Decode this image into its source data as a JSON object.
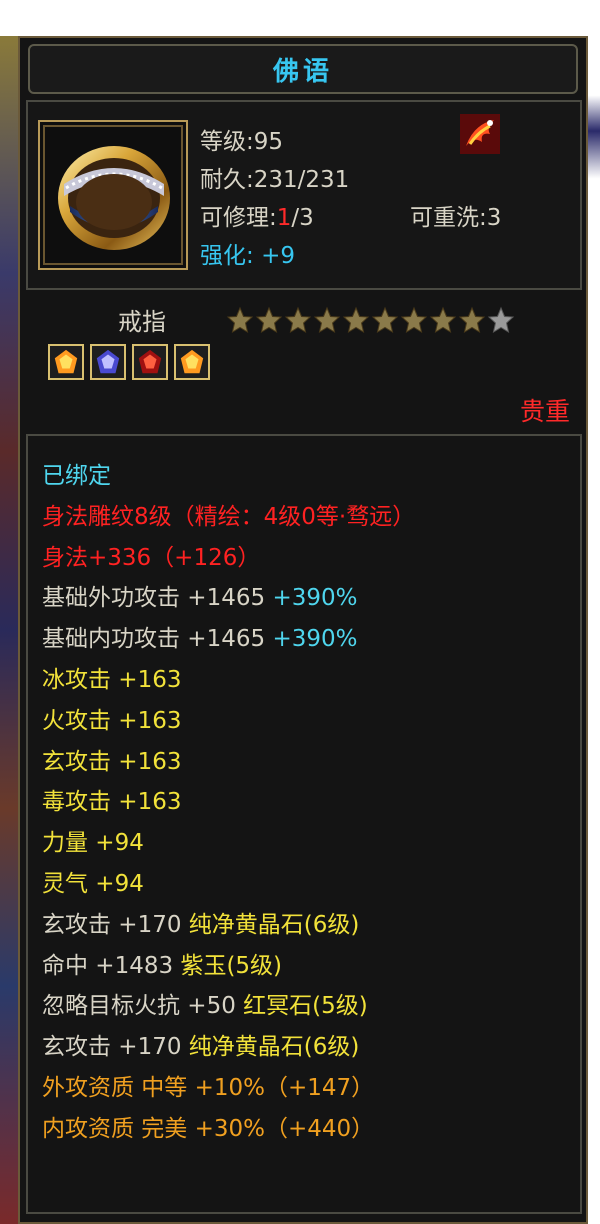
{
  "colors": {
    "title": "#37c6f0",
    "red": "#ff2222",
    "yellow": "#f2e23a",
    "orange": "#f0a020",
    "cyan": "#4fd6ee",
    "white": "#d8d4c6"
  },
  "item": {
    "name": "佛语",
    "level_label": "等级",
    "level_value": "95",
    "durability_label": "耐久",
    "durability_value": "231/231",
    "repair_label": "可修理",
    "repair_current": "1",
    "repair_total": "/3",
    "rewash_label": "可重洗",
    "rewash_value": "3",
    "enhance_label": "强化",
    "enhance_value": "+9",
    "type": "戒指",
    "stars_filled": 9,
    "stars_total": 10,
    "gem_icons": [
      "yellow-gem-icon",
      "purple-gem-icon",
      "red-gem-icon",
      "yellow-gem-icon"
    ],
    "rarity": "贵重"
  },
  "attributes": [
    {
      "parts": [
        {
          "text": "已绑定",
          "color": "cyan"
        }
      ]
    },
    {
      "parts": [
        {
          "text": "身法雕纹8级（精绘：4级0等·骛远）",
          "color": "red"
        }
      ]
    },
    {
      "parts": [
        {
          "text": "身法+336（+126）",
          "color": "red"
        }
      ]
    },
    {
      "parts": [
        {
          "text": "基础外功攻击 +1465 ",
          "color": "white"
        },
        {
          "text": "+390%",
          "color": "cyan"
        }
      ]
    },
    {
      "parts": [
        {
          "text": "基础内功攻击 +1465 ",
          "color": "white"
        },
        {
          "text": "+390%",
          "color": "cyan"
        }
      ]
    },
    {
      "parts": [
        {
          "text": "冰攻击 +163",
          "color": "yellow"
        }
      ]
    },
    {
      "parts": [
        {
          "text": "火攻击 +163",
          "color": "yellow"
        }
      ]
    },
    {
      "parts": [
        {
          "text": "玄攻击 +163",
          "color": "yellow"
        }
      ]
    },
    {
      "parts": [
        {
          "text": "毒攻击 +163",
          "color": "yellow"
        }
      ]
    },
    {
      "parts": [
        {
          "text": "力量 +94",
          "color": "yellow"
        }
      ]
    },
    {
      "parts": [
        {
          "text": "灵气 +94",
          "color": "yellow"
        }
      ]
    },
    {
      "parts": [
        {
          "text": "玄攻击 +170 ",
          "color": "white"
        },
        {
          "text": "纯净黄晶石(6级)",
          "color": "yellow"
        }
      ]
    },
    {
      "parts": [
        {
          "text": "命中 +1483 ",
          "color": "white"
        },
        {
          "text": "紫玉(5级)",
          "color": "yellow"
        }
      ]
    },
    {
      "parts": [
        {
          "text": "忽略目标火抗 +50 ",
          "color": "white"
        },
        {
          "text": "红冥石(5级)",
          "color": "yellow"
        }
      ]
    },
    {
      "parts": [
        {
          "text": "玄攻击 +170 ",
          "color": "white"
        },
        {
          "text": "纯净黄晶石(6级)",
          "color": "yellow"
        }
      ]
    },
    {
      "parts": [
        {
          "text": "外攻资质  中等 +10%（+147）",
          "color": "orange"
        }
      ]
    },
    {
      "parts": [
        {
          "text": "内攻资质  完美 +30%（+440）",
          "color": "orange"
        }
      ]
    }
  ]
}
